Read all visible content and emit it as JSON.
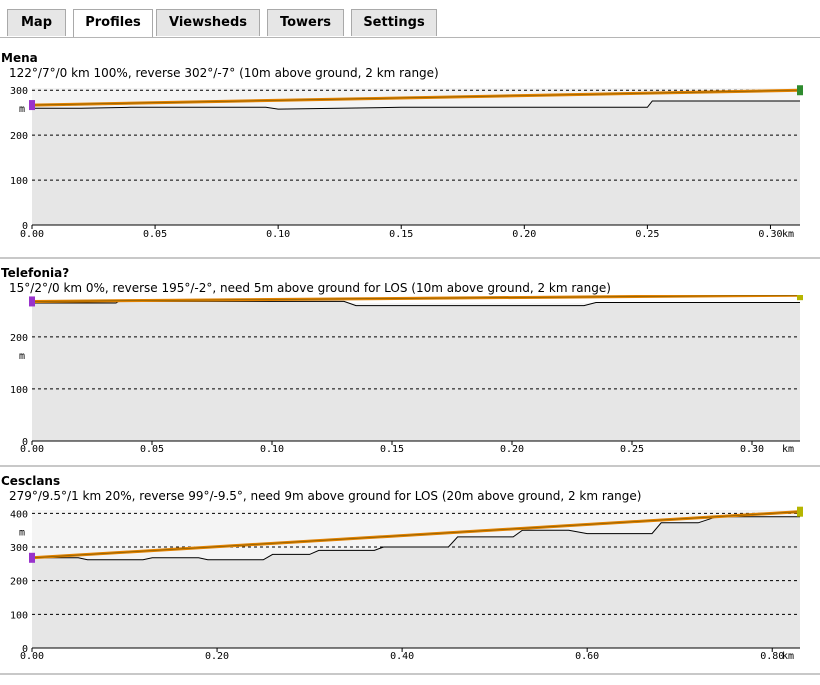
{
  "tabs": [
    {
      "label": "Map",
      "active": false
    },
    {
      "label": "Profiles",
      "active": true
    },
    {
      "label": "Viewsheds",
      "active": false
    },
    {
      "label": "Towers",
      "active": false
    },
    {
      "label": "Settings",
      "active": false
    }
  ],
  "colors": {
    "start_marker": "#9932cc",
    "end_marker_1": "#2e8b2e",
    "end_marker_other": "#b5b500",
    "los_line": "#e08000",
    "terrain_fill": "#e6e6e6"
  },
  "profiles": [
    {
      "title": "Mena",
      "subtitle": "122°/7°/0 km 100%, reverse 302°/-7° (10m above ground, 2 km range)",
      "unit": "m",
      "x_unit": "km",
      "chart_data": {
        "type": "area",
        "xlabel": "km",
        "ylabel": "m",
        "xlim": [
          0,
          0.312
        ],
        "ylim": [
          0,
          305
        ],
        "xticks": [
          "0.00",
          "0.05",
          "0.10",
          "0.15",
          "0.20",
          "0.25",
          "0.30"
        ],
        "yticks": [
          "300",
          "200",
          "100",
          "0"
        ],
        "tick_values_x": [
          0,
          0.05,
          0.1,
          0.15,
          0.2,
          0.25,
          0.3
        ],
        "tick_values_y": [
          300,
          200,
          100,
          0
        ],
        "series": [
          {
            "x": [
              0,
              0.02,
              0.04,
              0.095,
              0.1,
              0.15,
              0.2,
              0.25,
              0.252,
              0.258,
              0.3,
              0.312
            ],
            "y": [
              260,
              260,
              262,
              262,
              258,
              262,
              262,
              262,
              276,
              276,
              276,
              276
            ]
          }
        ],
        "los": {
          "x": [
            0,
            0.312
          ],
          "y": [
            267,
            300
          ]
        }
      }
    },
    {
      "title": "Telefonia?",
      "subtitle": "15°/2°/0 km 0%, reverse 195°/-2°, need 5m above ground for LOS (10m above ground, 2 km range)",
      "unit": "m",
      "x_unit": "km",
      "chart_data": {
        "type": "area",
        "xlabel": "km",
        "ylabel": "m",
        "xlim": [
          0,
          0.32
        ],
        "ylim": [
          0,
          265
        ],
        "xticks": [
          "0.00",
          "0.05",
          "0.10",
          "0.15",
          "0.20",
          "0.25",
          "0.30"
        ],
        "yticks": [
          "200",
          "100",
          "0"
        ],
        "tick_values_x": [
          0,
          0.05,
          0.1,
          0.15,
          0.2,
          0.25,
          0.3
        ],
        "tick_values_y": [
          200,
          100,
          0
        ],
        "series": [
          {
            "x": [
              0,
              0.035,
              0.036,
              0.13,
              0.135,
              0.23,
              0.235,
              0.3,
              0.32
            ],
            "y": [
              265,
              265,
              268,
              268,
              260,
              260,
              266,
              266,
              266
            ]
          }
        ],
        "los": {
          "x": [
            0,
            0.32
          ],
          "y": [
            268,
            280
          ]
        }
      }
    },
    {
      "title": "Cesclans",
      "subtitle": "279°/9.5°/1 km 20%, reverse 99°/-9.5°, need 9m above ground for LOS (20m above ground, 2 km range)",
      "unit": "m",
      "x_unit": "km",
      "chart_data": {
        "type": "area",
        "xlabel": "km",
        "ylabel": "m",
        "xlim": [
          0,
          0.83
        ],
        "ylim": [
          0,
          410
        ],
        "xticks": [
          "0.00",
          "0.20",
          "0.40",
          "0.60",
          "0.80"
        ],
        "yticks": [
          "400",
          "300",
          "200",
          "100",
          "0"
        ],
        "tick_values_x": [
          0,
          0.2,
          0.4,
          0.6,
          0.8
        ],
        "tick_values_y": [
          400,
          300,
          200,
          100,
          0
        ],
        "series": [
          {
            "x": [
              0,
              0.05,
              0.06,
              0.12,
              0.13,
              0.18,
              0.19,
              0.25,
              0.26,
              0.3,
              0.31,
              0.37,
              0.38,
              0.45,
              0.46,
              0.52,
              0.53,
              0.58,
              0.6,
              0.67,
              0.68,
              0.72,
              0.74,
              0.83
            ],
            "y": [
              268,
              268,
              262,
              262,
              268,
              268,
              262,
              262,
              278,
              278,
              290,
              290,
              300,
              300,
              330,
              330,
              350,
              350,
              340,
              340,
              372,
              372,
              390,
              390
            ]
          }
        ],
        "los": {
          "x": [
            0,
            0.83
          ],
          "y": [
            268,
            405
          ]
        }
      }
    }
  ]
}
